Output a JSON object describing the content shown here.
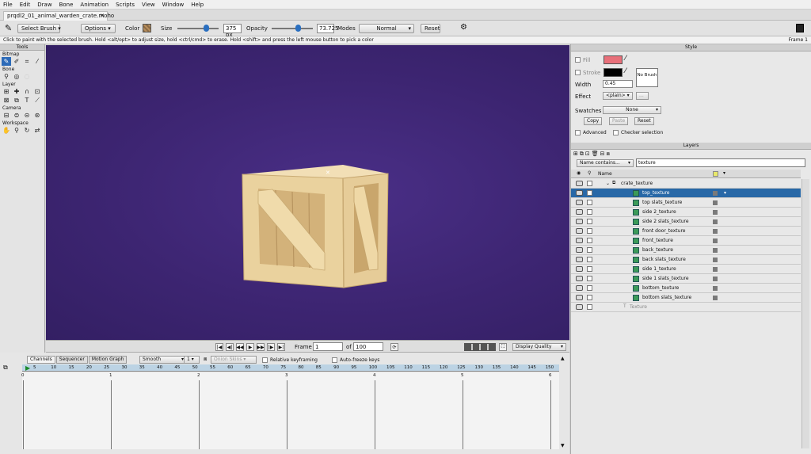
{
  "menu": [
    "File",
    "Edit",
    "Draw",
    "Bone",
    "Animation",
    "Scripts",
    "View",
    "Window",
    "Help"
  ],
  "document_tab": "prqdl2_01_animal_warden_crate.moho",
  "toolbar": {
    "tool_select": "Select Brush",
    "options": "Options",
    "color_label": "Color",
    "size_label": "Size",
    "size_value": "375 px",
    "opacity_label": "Opacity",
    "opacity_value": "73.725",
    "modes_label": "Modes",
    "modes_value": "Normal",
    "reset": "Reset"
  },
  "status": {
    "text": "Click to paint with the selected brush. Hold <alt/opt> to adjust size, hold <ctrl/cmd> to erase. Hold <shift> and press the left mouse button to pick a color",
    "frame": "Frame 1"
  },
  "tools": {
    "title": "Tools",
    "groups": [
      "Bitmap",
      "Bone",
      "Layer",
      "Camera",
      "Workspace"
    ]
  },
  "style": {
    "title": "Style",
    "fill_label": "Fill",
    "stroke_label": "Stroke",
    "width_label": "Width",
    "width_value": "0.45",
    "effect_label": "Effect",
    "effect_value": "<plain>",
    "effect_more": "...",
    "brush_label": "No Brush",
    "swatches_label": "Swatches",
    "swatches_value": "None",
    "copy": "Copy",
    "paste": "Paste",
    "reset": "Reset",
    "advanced": "Advanced",
    "checker": "Checker selection",
    "fill_color": "#e8707a",
    "stroke_color": "#000000"
  },
  "layers": {
    "title": "Layers",
    "filter_mode": "Name contains...",
    "filter_value": "texture",
    "col_name": "Name",
    "group": "crate_texture",
    "items": [
      {
        "name": "top_texture",
        "selected": true
      },
      {
        "name": "top slats_texture"
      },
      {
        "name": "side 2_texture"
      },
      {
        "name": "side 2 slats_texture"
      },
      {
        "name": "front door_texture"
      },
      {
        "name": "front_texture"
      },
      {
        "name": "back_texture"
      },
      {
        "name": "back slats_texture"
      },
      {
        "name": "side 1_texture"
      },
      {
        "name": "side 1 slats_texture"
      },
      {
        "name": "bottom_texture"
      },
      {
        "name": "bottom slats_texture"
      }
    ],
    "trailing": "Texture"
  },
  "playback": {
    "frame_label": "Frame",
    "frame_value": "1",
    "of_label": "of",
    "total": "100",
    "quality": "Display Quality"
  },
  "timeline": {
    "tabs": [
      "Channels",
      "Sequencer",
      "Motion Graph"
    ],
    "interp": "Smooth",
    "interp_num": "1",
    "onion": "Onion Skins",
    "relative": "Relative keyframing",
    "autofreeze": "Auto-freeze keys",
    "ruler": [
      "5",
      "10",
      "15",
      "20",
      "25",
      "30",
      "35",
      "40",
      "45",
      "50",
      "55",
      "60",
      "65",
      "70",
      "75",
      "80",
      "85",
      "90",
      "95",
      "100",
      "105",
      "110",
      "115",
      "120",
      "125",
      "130",
      "135",
      "140",
      "145",
      "150"
    ],
    "sections": [
      "0",
      "1",
      "2",
      "3",
      "4",
      "5",
      "6"
    ]
  },
  "colors": {
    "canvas": "#3d2572",
    "selection": "#2868a7",
    "crate": "#e9cf9a"
  }
}
